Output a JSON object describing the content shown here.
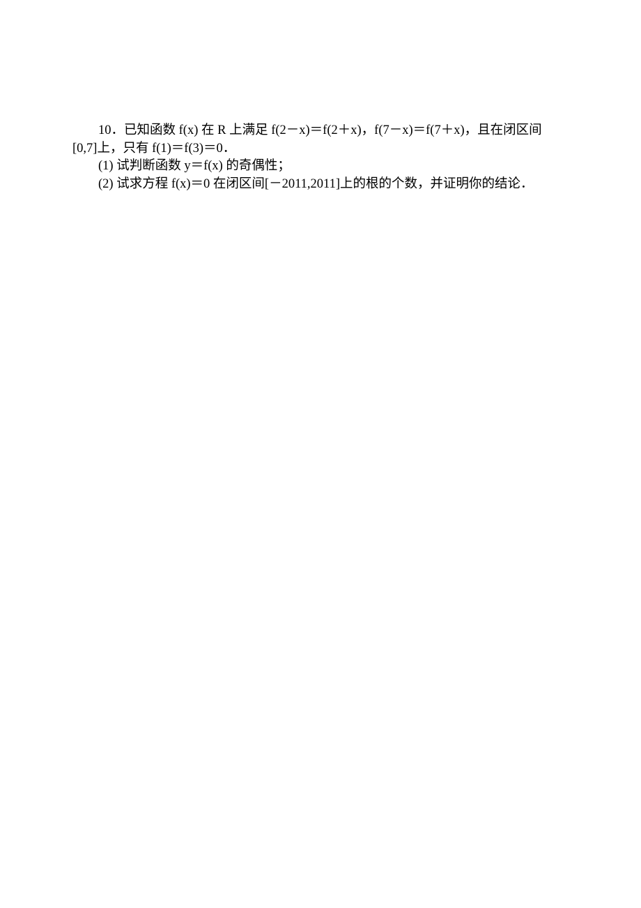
{
  "problem": {
    "line1": "10．已知函数 f(x) 在 R 上满足 f(2－x)＝f(2＋x)，f(7－x)＝f(7＋x)，且在闭区间",
    "line2": "[0,7]上，只有 f(1)＝f(3)＝0．",
    "q1": "(1) 试判断函数 y＝f(x) 的奇偶性；",
    "q2": "(2) 试求方程 f(x)＝0 在闭区间[－2011,2011]上的根的个数，并证明你的结论．"
  }
}
